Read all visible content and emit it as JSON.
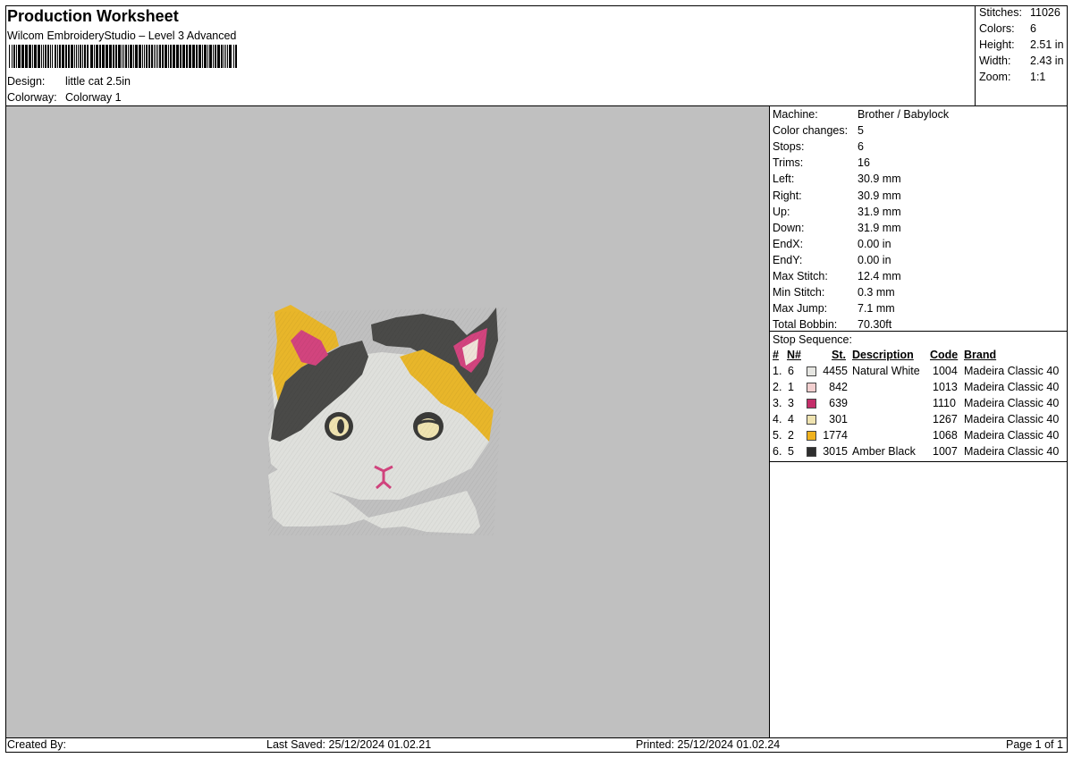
{
  "header": {
    "title": "Production Worksheet",
    "software": "Wilcom EmbroideryStudio – Level 3 Advanced",
    "design_label": "Design:",
    "design_value": "little cat 2.5in",
    "colorway_label": "Colorway:",
    "colorway_value": "Colorway 1"
  },
  "summary": [
    {
      "label": "Stitches:",
      "value": "11026"
    },
    {
      "label": "Colors:",
      "value": "6"
    },
    {
      "label": "Height:",
      "value": "2.51 in"
    },
    {
      "label": "Width:",
      "value": "2.43 in"
    },
    {
      "label": "Zoom:",
      "value": "1:1"
    }
  ],
  "machine_stats": [
    {
      "label": "Machine:",
      "value": "Brother / Babylock"
    },
    {
      "label": "Color changes:",
      "value": "5"
    },
    {
      "label": "Stops:",
      "value": "6"
    },
    {
      "label": "Trims:",
      "value": "16"
    },
    {
      "label": "Left:",
      "value": "30.9 mm"
    },
    {
      "label": "Right:",
      "value": "30.9 mm"
    },
    {
      "label": "Up:",
      "value": "31.9 mm"
    },
    {
      "label": "Down:",
      "value": "31.9 mm"
    },
    {
      "label": "EndX:",
      "value": "0.00 in"
    },
    {
      "label": "EndY:",
      "value": "0.00 in"
    },
    {
      "label": "Max Stitch:",
      "value": "12.4 mm"
    },
    {
      "label": "Min Stitch:",
      "value": "0.3 mm"
    },
    {
      "label": "Max Jump:",
      "value": "7.1 mm"
    },
    {
      "label": "Total Bobbin:",
      "value": "70.30ft"
    }
  ],
  "stop_sequence": {
    "title": "Stop Sequence:",
    "headers": {
      "num": "#",
      "n": "N#",
      "st": "St.",
      "description": "Description",
      "code": "Code",
      "brand": "Brand"
    },
    "rows": [
      {
        "num": "1.",
        "n": "6",
        "color": "#e6e6e2",
        "st": "4455",
        "description": "Natural White",
        "code": "1004",
        "brand": "Madeira Classic 40"
      },
      {
        "num": "2.",
        "n": "1",
        "color": "#f2cfcf",
        "st": "842",
        "description": "",
        "code": "1013",
        "brand": "Madeira Classic 40"
      },
      {
        "num": "3.",
        "n": "3",
        "color": "#c42e6a",
        "st": "639",
        "description": "",
        "code": "1110",
        "brand": "Madeira Classic 40"
      },
      {
        "num": "4.",
        "n": "4",
        "color": "#efe3b0",
        "st": "301",
        "description": "",
        "code": "1267",
        "brand": "Madeira Classic 40"
      },
      {
        "num": "5.",
        "n": "2",
        "color": "#f0b21e",
        "st": "1774",
        "description": "",
        "code": "1068",
        "brand": "Madeira Classic 40"
      },
      {
        "num": "6.",
        "n": "5",
        "color": "#2e2e2e",
        "st": "3015",
        "description": "Amber Black",
        "code": "1007",
        "brand": "Madeira Classic 40"
      }
    ]
  },
  "footer": {
    "created_by": "Created By:",
    "last_saved": "Last Saved: 25/12/2024 01.02.21",
    "printed": "Printed: 25/12/2024 01.02.24",
    "page": "Page 1 of 1"
  },
  "colors": {
    "preview_bg": "#c0c0c0",
    "cat_white": "#dfe0dc",
    "cat_black": "#4a4a48",
    "cat_gold": "#e8b62a",
    "cat_pink": "#d2447e"
  }
}
